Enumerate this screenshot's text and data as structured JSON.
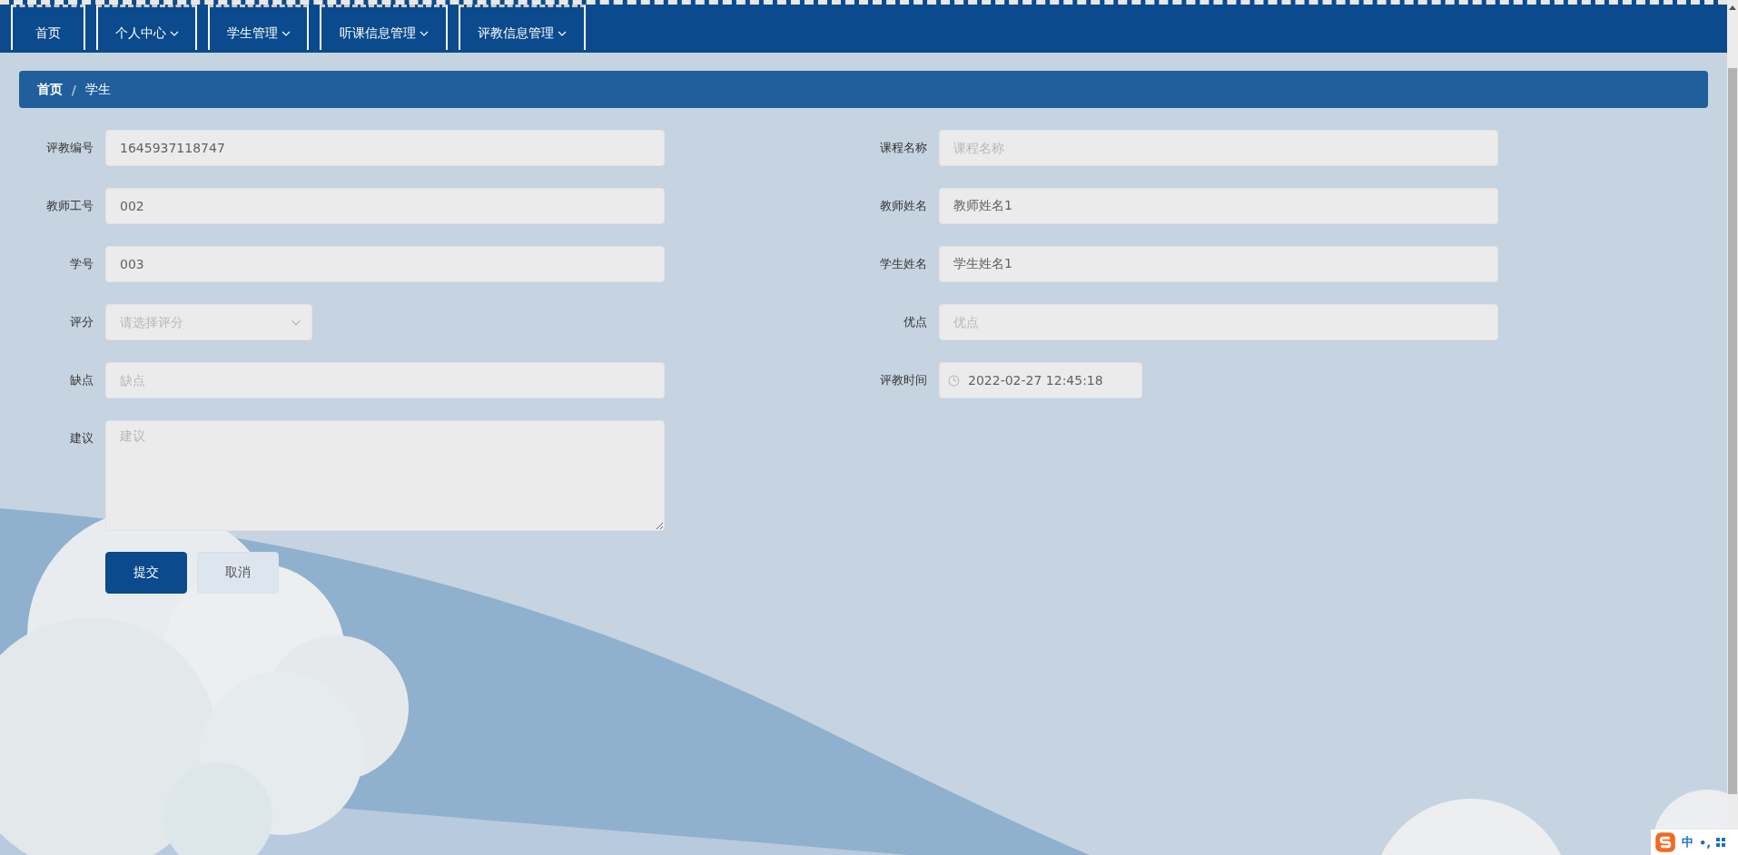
{
  "nav": {
    "tabs": [
      {
        "label": "首页",
        "has_menu": false
      },
      {
        "label": "个人中心",
        "has_menu": true
      },
      {
        "label": "学生管理",
        "has_menu": true
      },
      {
        "label": "听课信息管理",
        "has_menu": true
      },
      {
        "label": "评教信息管理",
        "has_menu": true
      }
    ]
  },
  "breadcrumb": {
    "items": [
      "首页",
      "学生"
    ],
    "separator": "/"
  },
  "form": {
    "left": [
      {
        "label": "评教编号",
        "kind": "input",
        "value": "1645937118747"
      },
      {
        "label": "教师工号",
        "kind": "input",
        "value": "002"
      },
      {
        "label": "学号",
        "kind": "input",
        "value": "003"
      },
      {
        "label": "评分",
        "kind": "select",
        "placeholder": "请选择评分"
      },
      {
        "label": "缺点",
        "kind": "input",
        "placeholder": "缺点"
      },
      {
        "label": "建议",
        "kind": "textarea",
        "placeholder": "建议"
      }
    ],
    "right": [
      {
        "label": "课程名称",
        "kind": "input",
        "placeholder": "课程名称"
      },
      {
        "label": "教师姓名",
        "kind": "input",
        "value": "教师姓名1"
      },
      {
        "label": "学生姓名",
        "kind": "input",
        "value": "学生姓名1"
      },
      {
        "label": "优点",
        "kind": "input",
        "placeholder": "优点"
      },
      {
        "label": "评教时间",
        "kind": "datetime",
        "value": "2022-02-27 12:45:18"
      }
    ]
  },
  "buttons": [
    {
      "label": "提交",
      "kind": "primary"
    },
    {
      "label": "取消",
      "kind": "default"
    }
  ],
  "ime": {
    "mode": "中",
    "punctuation": "•,"
  }
}
